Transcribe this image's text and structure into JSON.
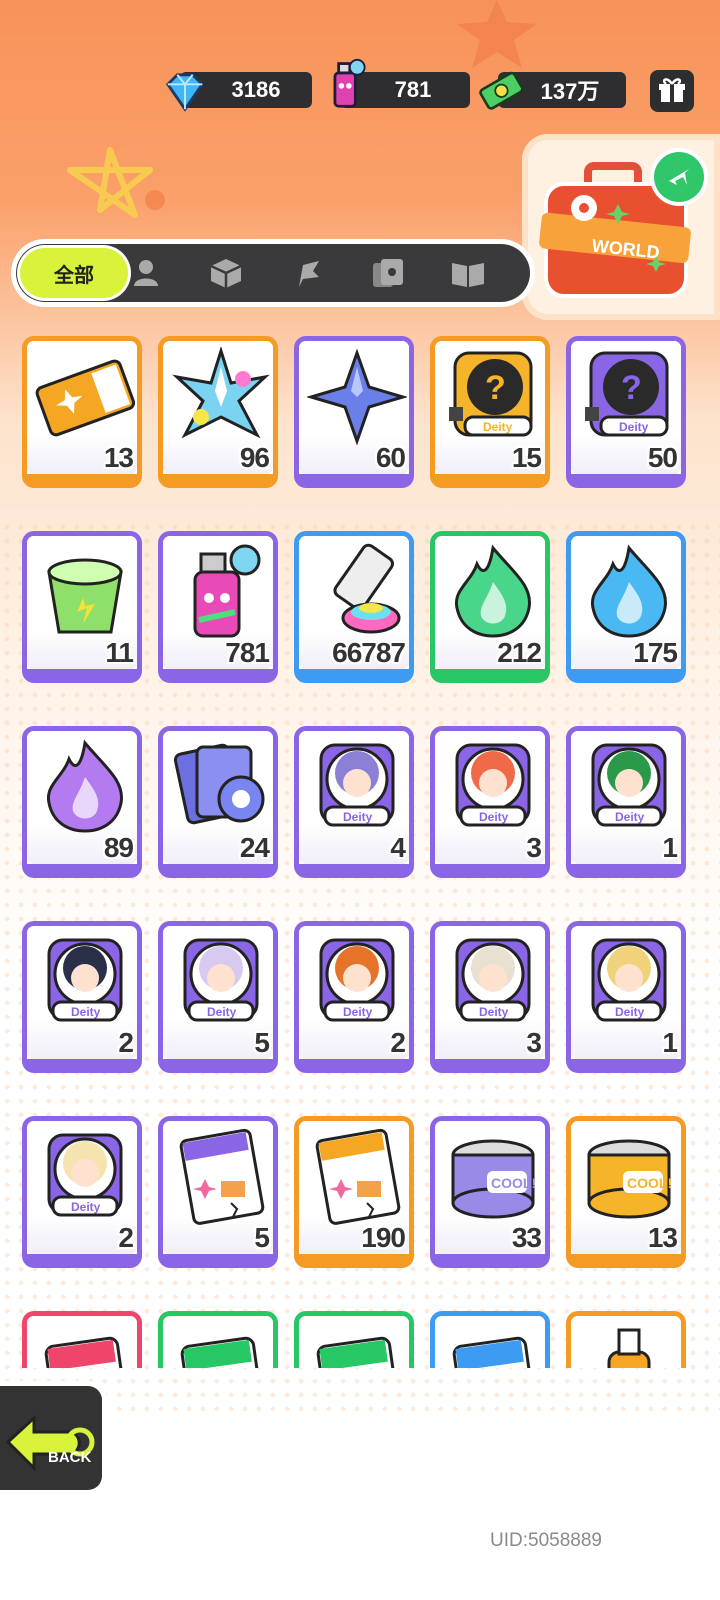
{
  "currency": {
    "diamonds": "3186",
    "spray": "781",
    "cash": "137万"
  },
  "tabs": {
    "all_label": "全部",
    "icons": [
      "person-icon",
      "box-icon",
      "flag-icon",
      "cards-icon",
      "book-icon"
    ]
  },
  "world_badge": "WORLD",
  "deity_label": "Deity",
  "items": [
    {
      "name": "ticket",
      "frame": "#f59a22",
      "qty": "13"
    },
    {
      "name": "rainbow-star",
      "frame": "#f59a22",
      "qty": "96"
    },
    {
      "name": "blue-star",
      "frame": "#8a65e6",
      "qty": "60"
    },
    {
      "name": "mystery-deity-gold",
      "frame": "#f59a22",
      "qty": "15"
    },
    {
      "name": "mystery-deity-purple",
      "frame": "#8a65e6",
      "qty": "50"
    },
    {
      "name": "green-cup",
      "frame": "#8a65e6",
      "qty": "11"
    },
    {
      "name": "spray-can",
      "frame": "#8a65e6",
      "qty": "781"
    },
    {
      "name": "paint-tube",
      "frame": "#3d9bf2",
      "qty": "66787"
    },
    {
      "name": "green-flame",
      "frame": "#27c766",
      "qty": "212"
    },
    {
      "name": "blue-flame",
      "frame": "#3d9bf2",
      "qty": "175"
    },
    {
      "name": "purple-flame",
      "frame": "#8a65e6",
      "qty": "89"
    },
    {
      "name": "tape-cards",
      "frame": "#8a65e6",
      "qty": "24"
    },
    {
      "name": "deity-portrait-1",
      "frame": "#8a65e6",
      "qty": "4"
    },
    {
      "name": "deity-portrait-2",
      "frame": "#8a65e6",
      "qty": "3"
    },
    {
      "name": "deity-portrait-3",
      "frame": "#8a65e6",
      "qty": "1"
    },
    {
      "name": "deity-portrait-4",
      "frame": "#8a65e6",
      "qty": "2"
    },
    {
      "name": "deity-portrait-5",
      "frame": "#8a65e6",
      "qty": "5"
    },
    {
      "name": "deity-portrait-6",
      "frame": "#8a65e6",
      "qty": "2"
    },
    {
      "name": "deity-portrait-7",
      "frame": "#8a65e6",
      "qty": "3"
    },
    {
      "name": "deity-portrait-8",
      "frame": "#8a65e6",
      "qty": "1"
    },
    {
      "name": "deity-portrait-9",
      "frame": "#8a65e6",
      "qty": "2"
    },
    {
      "name": "sticker-pack-purple",
      "frame": "#8a65e6",
      "qty": "5"
    },
    {
      "name": "sticker-pack-orange",
      "frame": "#f59a22",
      "qty": "190"
    },
    {
      "name": "cool-can-purple",
      "frame": "#8a65e6",
      "qty": "33"
    },
    {
      "name": "cool-can-orange",
      "frame": "#f59a22",
      "qty": "13"
    },
    {
      "name": "pack-red",
      "frame": "#f0456b",
      "qty": ""
    },
    {
      "name": "pack-green",
      "frame": "#27c766",
      "qty": ""
    },
    {
      "name": "pack-green-2",
      "frame": "#27c766",
      "qty": ""
    },
    {
      "name": "pack-blue",
      "frame": "#3d9bf2",
      "qty": ""
    },
    {
      "name": "bottle",
      "frame": "#f59a22",
      "qty": ""
    }
  ],
  "back_label": "BACK",
  "uid": "UID:5058889"
}
